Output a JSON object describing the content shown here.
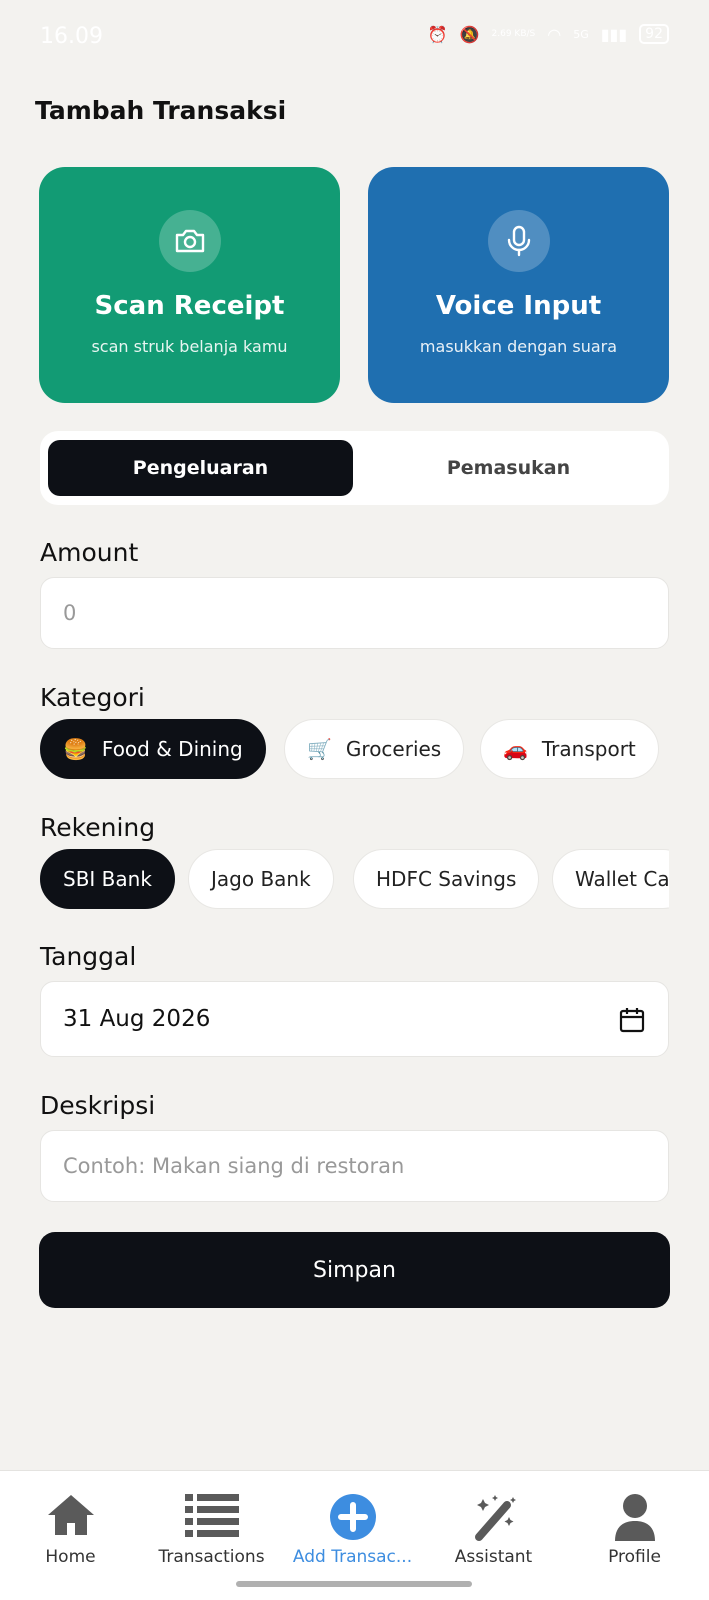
{
  "status_bar": {
    "time": "16.09",
    "battery": "92",
    "signal": "5G",
    "net_speed": "2.69 KB/S"
  },
  "page": {
    "title": "Tambah Transaksi"
  },
  "quick_actions": {
    "scan": {
      "title": "Scan Receipt",
      "subtitle": "scan struk belanja kamu",
      "icon": "camera-icon",
      "color": "#129b74"
    },
    "voice": {
      "title": "Voice Input",
      "subtitle": "masukkan dengan suara",
      "icon": "microphone-icon",
      "color": "#1f6fb0"
    }
  },
  "type_toggle": {
    "options": [
      "Pengeluaran",
      "Pemasukan"
    ],
    "selected": "Pengeluaran"
  },
  "amount": {
    "label": "Amount",
    "placeholder": "0"
  },
  "category": {
    "label": "Kategori",
    "items": [
      {
        "emoji": "🍔",
        "label": "Food & Dining",
        "selected": true
      },
      {
        "emoji": "🛒",
        "label": "Groceries",
        "selected": false
      },
      {
        "emoji": "🚗",
        "label": "Transport",
        "selected": false
      }
    ]
  },
  "account": {
    "label": "Rekening",
    "items": [
      {
        "label": "SBI Bank",
        "selected": true
      },
      {
        "label": "Jago Bank",
        "selected": false
      },
      {
        "label": "HDFC Savings",
        "selected": false
      },
      {
        "label": "Wallet Ca",
        "selected": false
      }
    ]
  },
  "date": {
    "label": "Tanggal",
    "value": "31 Aug 2026",
    "icon": "calendar-icon"
  },
  "description": {
    "label": "Deskripsi",
    "placeholder": "Contoh: Makan siang di restoran"
  },
  "save_label": "Simpan",
  "bottom_nav": {
    "active": "Add Transac...",
    "items": [
      {
        "label": "Home",
        "icon": "home-icon"
      },
      {
        "label": "Transactions",
        "icon": "list-icon"
      },
      {
        "label": "Add Transac...",
        "icon": "plus-circle-icon"
      },
      {
        "label": "Assistant",
        "icon": "magic-wand-icon"
      },
      {
        "label": "Profile",
        "icon": "person-icon"
      }
    ]
  },
  "colors": {
    "primary_dark": "#0d1016",
    "accent_blue": "#3d8de0",
    "background": "#f3f2ef"
  }
}
